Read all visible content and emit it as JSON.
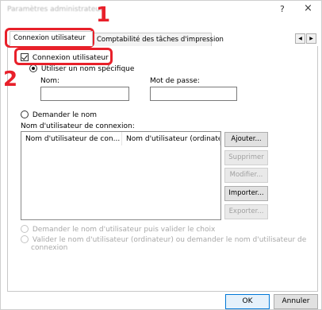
{
  "window": {
    "title": "Paramètres administrateur",
    "help_label": "?",
    "close_label": "×"
  },
  "tabs": [
    {
      "label": "Connexion utilisateur",
      "active": true
    },
    {
      "label": "Comptabilité des tâches d'impression",
      "active": false
    }
  ],
  "tab_scroll": {
    "left": "◀",
    "right": "▶"
  },
  "callouts": {
    "one": "1",
    "two": "2"
  },
  "login": {
    "checkbox_label": "Connexion utilisateur",
    "checked": true,
    "use_specific_name_label": "Utiliser un nom spécifique",
    "name_label": "Nom:",
    "name_value": "",
    "password_label": "Mot de passe:",
    "password_value": "",
    "ask_name_label": "Demander le nom",
    "login_user_name_label": "Nom d'utilisateur de connexion:"
  },
  "table": {
    "columns": [
      "Nom d'utilisateur de con...",
      "Nom d'utilisateur (ordinateur)"
    ],
    "rows": []
  },
  "side_buttons": {
    "add": "Ajouter...",
    "delete": "Supprimer",
    "modify": "Modifier...",
    "import": "Importer...",
    "export": "Exporter..."
  },
  "options": {
    "ask_and_validate": "Demander le nom d'utilisateur puis valider le choix",
    "validate_or_ask_line1": "Valider le nom d'utilisateur (ordinateur) ou demander le nom d'utilisateur de",
    "validate_or_ask_line2": "connexion"
  },
  "footer": {
    "ok": "OK",
    "cancel": "Annuler"
  },
  "colors": {
    "highlight_red": "#e8202a",
    "focus_blue": "#0078d7"
  }
}
